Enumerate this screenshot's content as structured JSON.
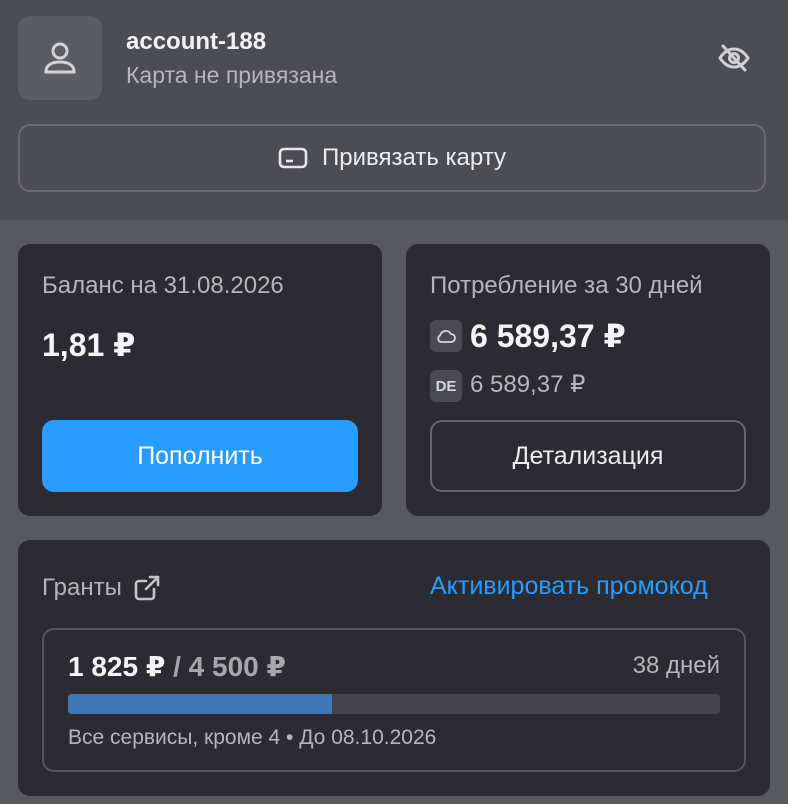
{
  "account": {
    "name": "account-188",
    "status": "Карта не привязана",
    "icons": {
      "avatar": "user-icon",
      "visibility": "eye-off-icon"
    }
  },
  "bind_card": {
    "label": "Привязать карту",
    "icon": "credit-card-icon"
  },
  "balance": {
    "label": "Баланс на 31.08.2026",
    "amount": "1,81 ₽",
    "button": "Пополнить"
  },
  "usage": {
    "label": "Потребление за 30 дней",
    "items": [
      {
        "icon": "cloud-icon",
        "amount": "6 589,37 ₽"
      },
      {
        "icon_text": "DE",
        "amount": "6 589,37 ₽"
      }
    ],
    "button": "Детализация"
  },
  "grants": {
    "label": "Гранты",
    "icon": "external-link-icon",
    "promo_link": "Активировать промокод",
    "grant": {
      "used": "1 825 ₽",
      "total": "/ 4 500 ₽",
      "days": "38 дней",
      "progress": 0.4056,
      "note": "Все сервисы, кроме 4 • До 08.10.2026"
    }
  },
  "colors": {
    "accent": "#2a9cff",
    "progress": "#3f78b8",
    "card": "#2b2b31"
  }
}
